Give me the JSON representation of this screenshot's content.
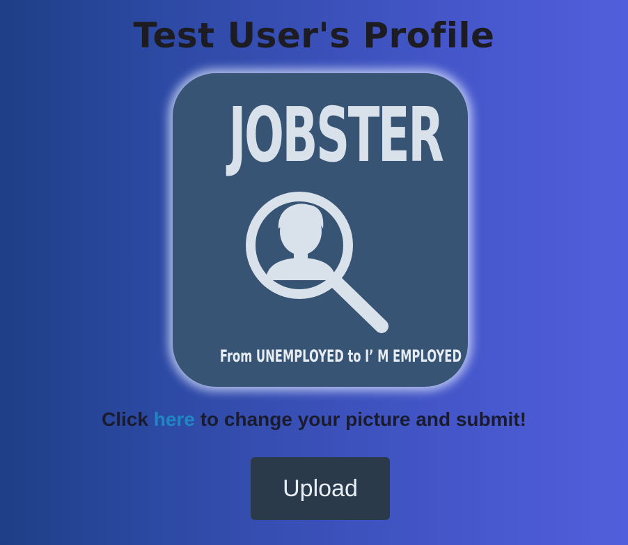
{
  "page": {
    "title": "Test User's Profile"
  },
  "profile_image": {
    "logo_text": "JOBSTER",
    "icon": "magnifier-person-icon",
    "tagline": "From UNEMPLOYED to I’ M EMPLOYED"
  },
  "instruction": {
    "before": "Click",
    "link": "here",
    "after": "to change your picture and submit!"
  },
  "upload_button": {
    "label": "Upload"
  },
  "colors": {
    "background_start": "#1e3f87",
    "background_end": "#525fdc",
    "card_bg": "#375474",
    "link": "#1f87c4",
    "button_bg": "#2b3a4b"
  }
}
